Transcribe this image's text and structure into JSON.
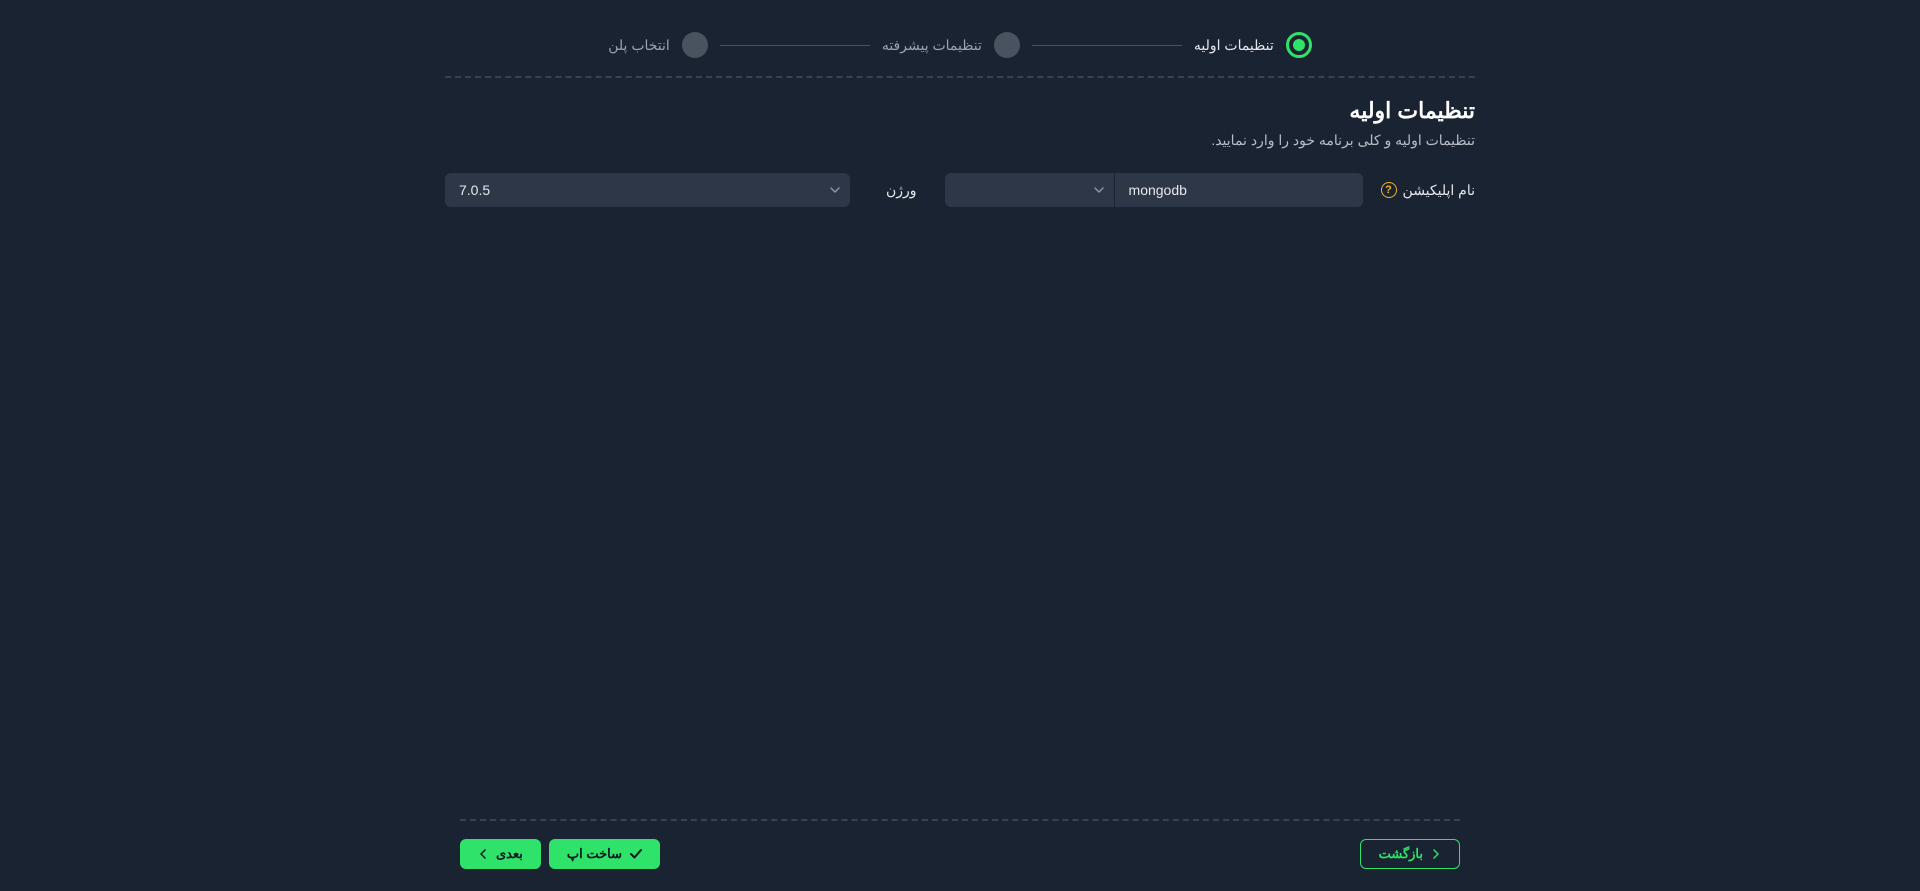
{
  "stepper": {
    "step1": "تنظیمات اولیه",
    "step2": "تنظیمات پیشرفته",
    "step3": "انتخاب پلن"
  },
  "section": {
    "title": "تنظیمات اولیه",
    "subtitle": "تنظیمات اولیه و کلی برنامه خود را وارد نمایید."
  },
  "form": {
    "app_name_label": "نام اپلیکیشن",
    "app_name_value": "mongodb",
    "app_select_value": "",
    "version_label": "ورژن",
    "version_value": "7.0.5"
  },
  "footer": {
    "back": "بازگشت",
    "create": "ساخت اپ",
    "next": "بعدی"
  }
}
